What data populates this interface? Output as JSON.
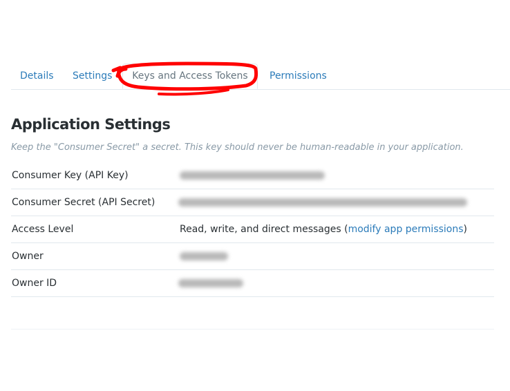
{
  "tabs": {
    "details": "Details",
    "settings": "Settings",
    "keys": "Keys and Access Tokens",
    "permissions": "Permissions",
    "active": "keys"
  },
  "section": {
    "title": "Application Settings",
    "note": "Keep the \"Consumer Secret\" a secret. This key should never be human-readable in your application."
  },
  "rows": [
    {
      "label": "Consumer Key (API Key)",
      "value_redacted": true
    },
    {
      "label": "Consumer Secret (API Secret)",
      "value_redacted": true
    },
    {
      "label": "Access Level",
      "value_prefix": "Read, write, and direct messages (",
      "value_link": "modify app permissions",
      "value_suffix": ")"
    },
    {
      "label": "Owner",
      "value_redacted": true
    },
    {
      "label": "Owner ID",
      "value_redacted": true
    }
  ],
  "colors": {
    "link": "#2b7bb9",
    "annotation": "#ff0000",
    "muted": "#8899a6"
  }
}
